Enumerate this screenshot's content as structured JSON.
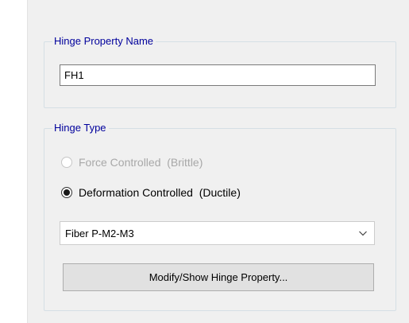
{
  "hinge_property_name": {
    "label": "Hinge Property Name",
    "value": "FH1"
  },
  "hinge_type": {
    "label": "Hinge Type",
    "options": [
      {
        "label": "Force Controlled  (Brittle)",
        "enabled": false,
        "selected": false
      },
      {
        "label": "Deformation Controlled  (Ductile)",
        "enabled": true,
        "selected": true
      }
    ],
    "dropdown_value": "Fiber P-M2-M3",
    "modify_button_label": "Modify/Show Hinge Property..."
  },
  "icons": {
    "dropdown_arrow": "chevron-down-icon"
  },
  "colors": {
    "group_label": "#00009c",
    "disabled_text": "#a8a8a8",
    "panel_background": "#f0f0f0",
    "button_background": "#e1e1e1"
  }
}
